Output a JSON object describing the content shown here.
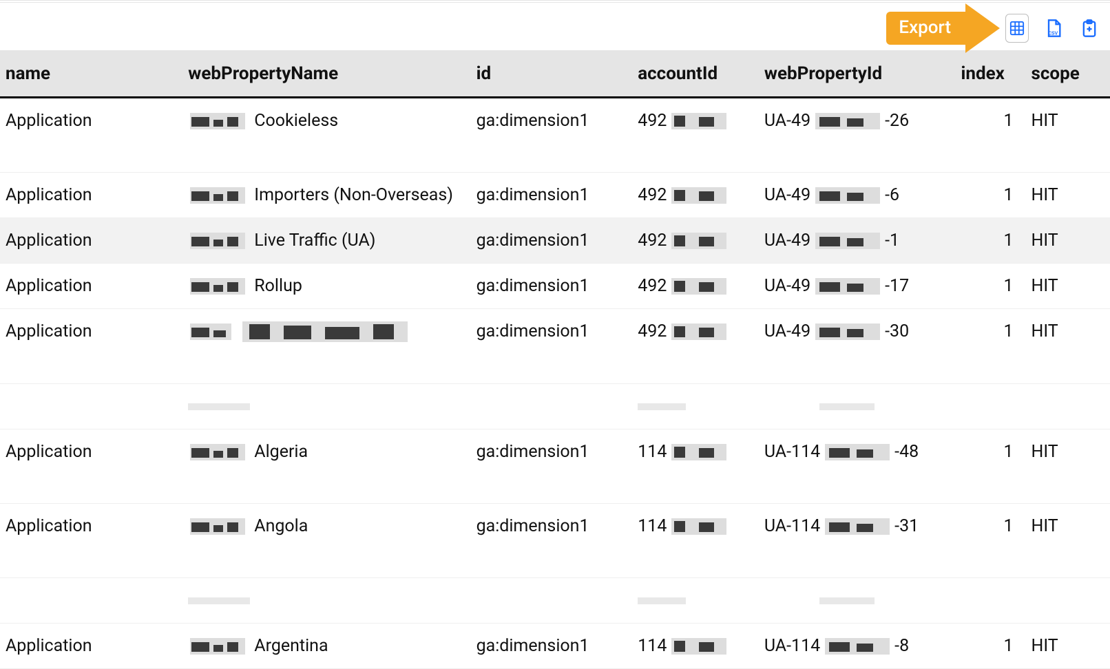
{
  "toolbar": {
    "export_label": "Export"
  },
  "columns": {
    "name": "name",
    "webPropertyName": "webPropertyName",
    "id": "id",
    "accountId": "accountId",
    "webPropertyId": "webPropertyId",
    "index": "index",
    "scope": "scope"
  },
  "rows": [
    {
      "name": "Application",
      "propSuffix": "Cookieless",
      "id": "ga:dimension1",
      "acctPrefix": "492",
      "wpPrefix": "UA-49",
      "wpSuffix": "-26",
      "index": "1",
      "scope": "HIT",
      "tall": true
    },
    {
      "name": "Application",
      "propSuffix": "Importers (Non-Overseas)",
      "id": "ga:dimension1",
      "acctPrefix": "492",
      "wpPrefix": "UA-49",
      "wpSuffix": "-6",
      "index": "1",
      "scope": "HIT"
    },
    {
      "name": "Application",
      "propSuffix": "Live Traffic (UA)",
      "id": "ga:dimension1",
      "acctPrefix": "492",
      "wpPrefix": "UA-49",
      "wpSuffix": "-1",
      "index": "1",
      "scope": "HIT",
      "highlight": true
    },
    {
      "name": "Application",
      "propSuffix": "Rollup",
      "id": "ga:dimension1",
      "acctPrefix": "492",
      "wpPrefix": "UA-49",
      "wpSuffix": "-17",
      "index": "1",
      "scope": "HIT"
    },
    {
      "name": "Application",
      "propSuffix": "",
      "id": "ga:dimension1",
      "acctPrefix": "492",
      "wpPrefix": "UA-49",
      "wpSuffix": "-30",
      "index": "1",
      "scope": "HIT",
      "tall": true,
      "propFullyRedacted": true
    },
    {
      "name": "Application",
      "propSuffix": "Algeria",
      "id": "ga:dimension1",
      "acctPrefix": "114",
      "wpPrefix": "UA-114",
      "wpSuffix": "-48",
      "index": "1",
      "scope": "HIT",
      "tall": true,
      "gapBefore": true
    },
    {
      "name": "Application",
      "propSuffix": "Angola",
      "id": "ga:dimension1",
      "acctPrefix": "114",
      "wpPrefix": "UA-114",
      "wpSuffix": "-31",
      "index": "1",
      "scope": "HIT",
      "tall": true
    },
    {
      "name": "Application",
      "propSuffix": "Argentina",
      "id": "ga:dimension1",
      "acctPrefix": "114",
      "wpPrefix": "UA-114",
      "wpSuffix": "-8",
      "index": "1",
      "scope": "HIT",
      "gapBefore": true
    }
  ]
}
